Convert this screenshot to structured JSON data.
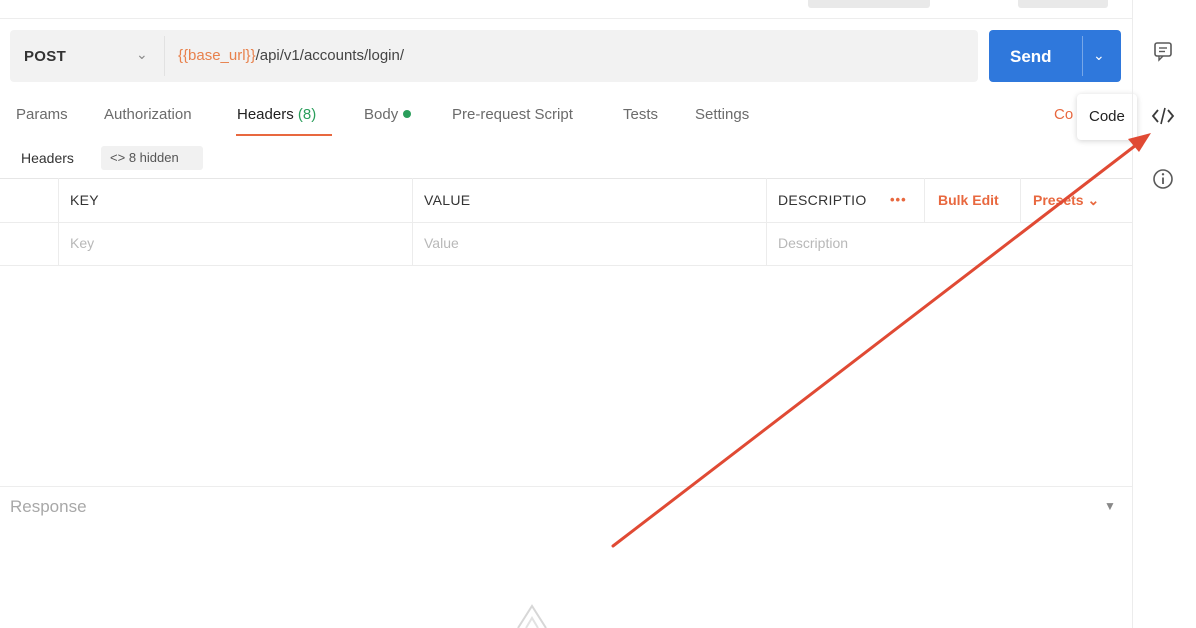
{
  "request": {
    "method": "POST",
    "url_variable": "{{base_url}}",
    "url_path": "/api/v1/accounts/login/",
    "send_label": "Send"
  },
  "tabs": {
    "params": "Params",
    "authorization": "Authorization",
    "headers": "Headers",
    "headers_count": "(8)",
    "body": "Body",
    "pre_request": "Pre-request Script",
    "tests": "Tests",
    "settings": "Settings",
    "cookies_partial": "Co"
  },
  "tooltip": {
    "label": "Code"
  },
  "headers_bar": {
    "title": "Headers",
    "hidden_label": "8 hidden",
    "hidden_icon": "eye-code-icon"
  },
  "table": {
    "columns": [
      "KEY",
      "VALUE",
      "DESCRIPTIO"
    ],
    "placeholders": {
      "key": "Key",
      "value": "Value",
      "description": "Description"
    },
    "more_label": "•••",
    "bulk_edit": "Bulk Edit",
    "presets": "Presets"
  },
  "response": {
    "label": "Response"
  },
  "rail_icons": [
    "comment-icon",
    "code-icon",
    "info-icon"
  ],
  "colors": {
    "accent": "#e8683f",
    "send_blue": "#2f78dc",
    "success_green": "#2a9e5b",
    "annotation_red": "#e04a34"
  }
}
